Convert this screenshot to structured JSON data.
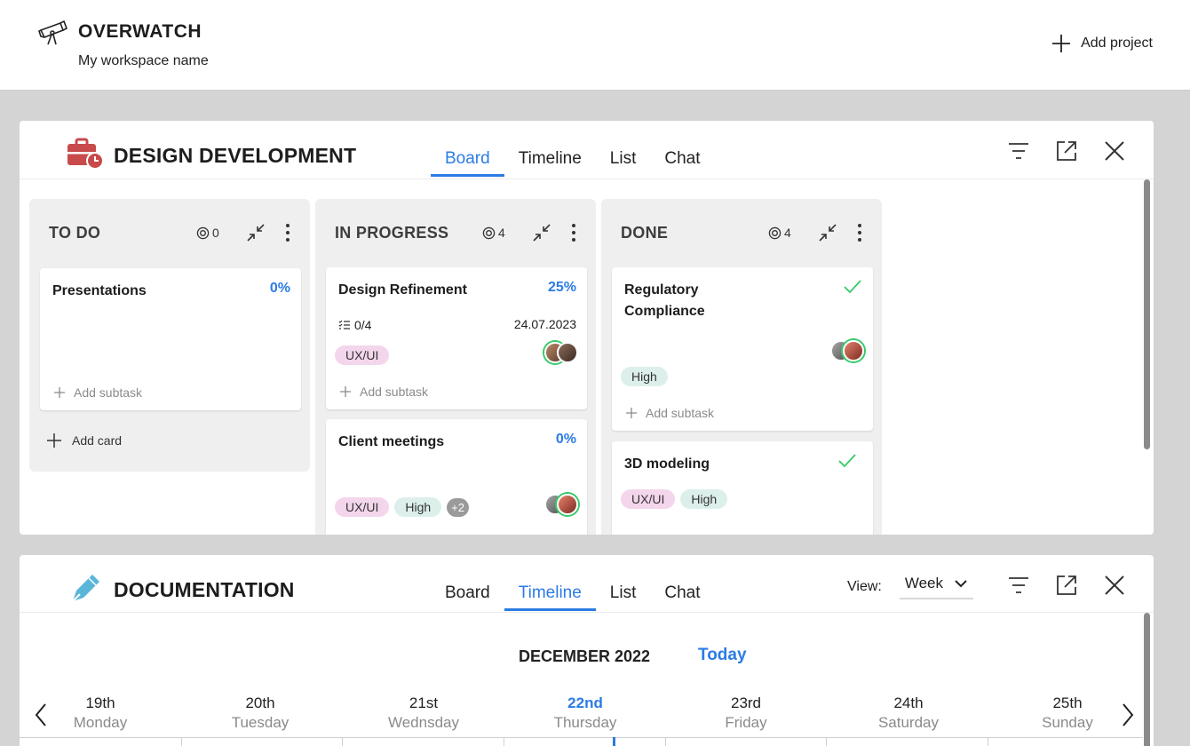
{
  "app": {
    "name": "OVERWATCH",
    "workspace": "My workspace name",
    "add_project_label": "Add project"
  },
  "colors": {
    "accent": "#2c7be5",
    "done_check": "#35c96a",
    "tag_uxui": "#f4d6ec",
    "tag_high": "#dcefeb",
    "project1_icon": "#c94a4a",
    "project2_icon": "#5ab6d8"
  },
  "projects": [
    {
      "title": "DESIGN DEVELOPMENT",
      "icon": "briefcase-clock-icon",
      "tabs": [
        "Board",
        "Timeline",
        "List",
        "Chat"
      ],
      "active_tab": "Board",
      "columns": [
        {
          "title": "TO DO",
          "count": "0",
          "cards": [
            {
              "title": "Presentations",
              "progress": "0%",
              "add_subtask": "Add subtask"
            }
          ],
          "add_card": "Add card"
        },
        {
          "title": "IN PROGRESS",
          "count": "4",
          "cards": [
            {
              "title": "Design Refinement",
              "progress": "25%",
              "subtasks": "0/4",
              "date": "24.07.2023",
              "tags": [
                "UX/UI"
              ],
              "add_subtask": "Add subtask"
            },
            {
              "title": "Client meetings",
              "progress": "0%",
              "tags": [
                "UX/UI",
                "High"
              ],
              "more_tags": "+2"
            }
          ]
        },
        {
          "title": "DONE",
          "count": "4",
          "cards": [
            {
              "title_line1": "Regulatory",
              "title_line2": "Compliance",
              "tags": [
                "High"
              ],
              "add_subtask": "Add subtask"
            },
            {
              "title": "3D modeling",
              "tags": [
                "UX/UI",
                "High"
              ]
            }
          ]
        }
      ]
    },
    {
      "title": "DOCUMENTATION",
      "icon": "pen-nib-icon",
      "tabs": [
        "Board",
        "Timeline",
        "List",
        "Chat"
      ],
      "active_tab": "Timeline",
      "view_label": "View:",
      "view_value": "Week",
      "timeline": {
        "month": "DECEMBER 2022",
        "today_label": "Today",
        "days": [
          {
            "num": "19th",
            "name": "Monday"
          },
          {
            "num": "20th",
            "name": "Tuesday"
          },
          {
            "num": "21st",
            "name": "Wednsday"
          },
          {
            "num": "22nd",
            "name": "Thursday"
          },
          {
            "num": "23rd",
            "name": "Friday"
          },
          {
            "num": "24th",
            "name": "Saturday"
          },
          {
            "num": "25th",
            "name": "Sunday"
          }
        ]
      }
    }
  ]
}
